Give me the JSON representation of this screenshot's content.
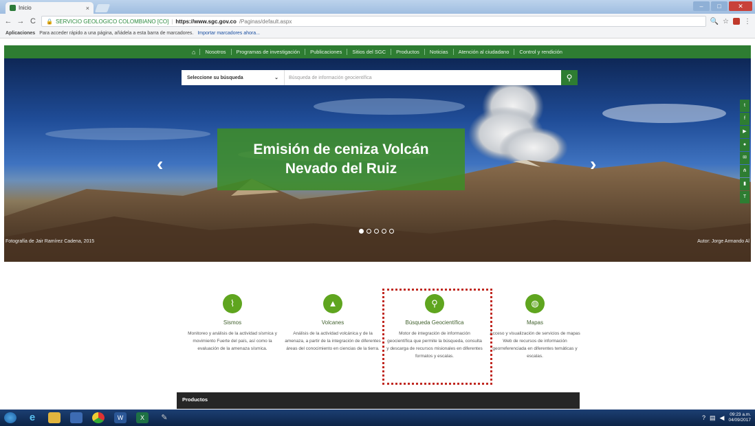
{
  "browser": {
    "tab_title": "Inicio",
    "tab_close": "×",
    "nav_back": "←",
    "nav_forward": "→",
    "nav_reload": "C",
    "secure_label": "SERVICIO GEOLOGICO COLOMBIANO [CO]",
    "url_domain": "https://www.sgc.gov.co",
    "url_path": "/Paginas/default.aspx",
    "bookmarks_apps": "Aplicaciones",
    "bookmarks_hint": "Para acceder rápido a una página, añádela a esta barra de marcadores.",
    "bookmarks_link": "Importar marcadores ahora..."
  },
  "site_nav": {
    "items": [
      {
        "label": "Nosotros"
      },
      {
        "label": "Programas de investigación"
      },
      {
        "label": "Publicaciones"
      },
      {
        "label": "Sitios del SGC"
      },
      {
        "label": "Productos"
      },
      {
        "label": "Noticias"
      },
      {
        "label": "Atención al ciudadano"
      },
      {
        "label": "Control y rendición"
      }
    ]
  },
  "search": {
    "select_value": "Seleccione su búsqueda",
    "placeholder": "Búsqueda de información geocientífica"
  },
  "hero": {
    "title_line1": "Emisión de ceniza Volcán",
    "title_line2": "Nevado del Ruiz",
    "credit_left": "Fotografía de Jair Ramírez Cadena, 2015",
    "credit_right": "Autor: Jorge Armando Al",
    "slide_count": 5,
    "active_slide": 1,
    "social": [
      "twitter",
      "facebook",
      "youtube",
      "flickr",
      "email",
      "sitemap",
      "rss",
      "accessibility"
    ]
  },
  "features": [
    {
      "title": "Sismos",
      "icon": "seismograph-icon",
      "desc": "Monitoreo y análisis de la actividad sísmica y movimiento Fuerte del país, así como la evaluación de la amenaza sísmica."
    },
    {
      "title": "Volcanes",
      "icon": "volcano-icon",
      "desc": "Análisis de la actividad volcánica y de la amenaza, a partir de la integración de diferentes áreas del conocimiento en ciencias de la tierra."
    },
    {
      "title": "Búsqueda Geocientífica",
      "icon": "search-icon",
      "desc": "Motor de integración de información geocientífica que permite la búsqueda, consulta y descarga de recursos misionales en diferentes formatos y escalas."
    },
    {
      "title": "Mapas",
      "icon": "globe-icon",
      "desc": "Acceso y visualización de servicios de mapas Web de recursos de información georreferenciada en diferentes temáticas y escalas."
    }
  ],
  "products": {
    "label": "Productos"
  },
  "taskbar": {
    "clock_time": "09:23 a.m.",
    "clock_date": "04/09/2017"
  }
}
